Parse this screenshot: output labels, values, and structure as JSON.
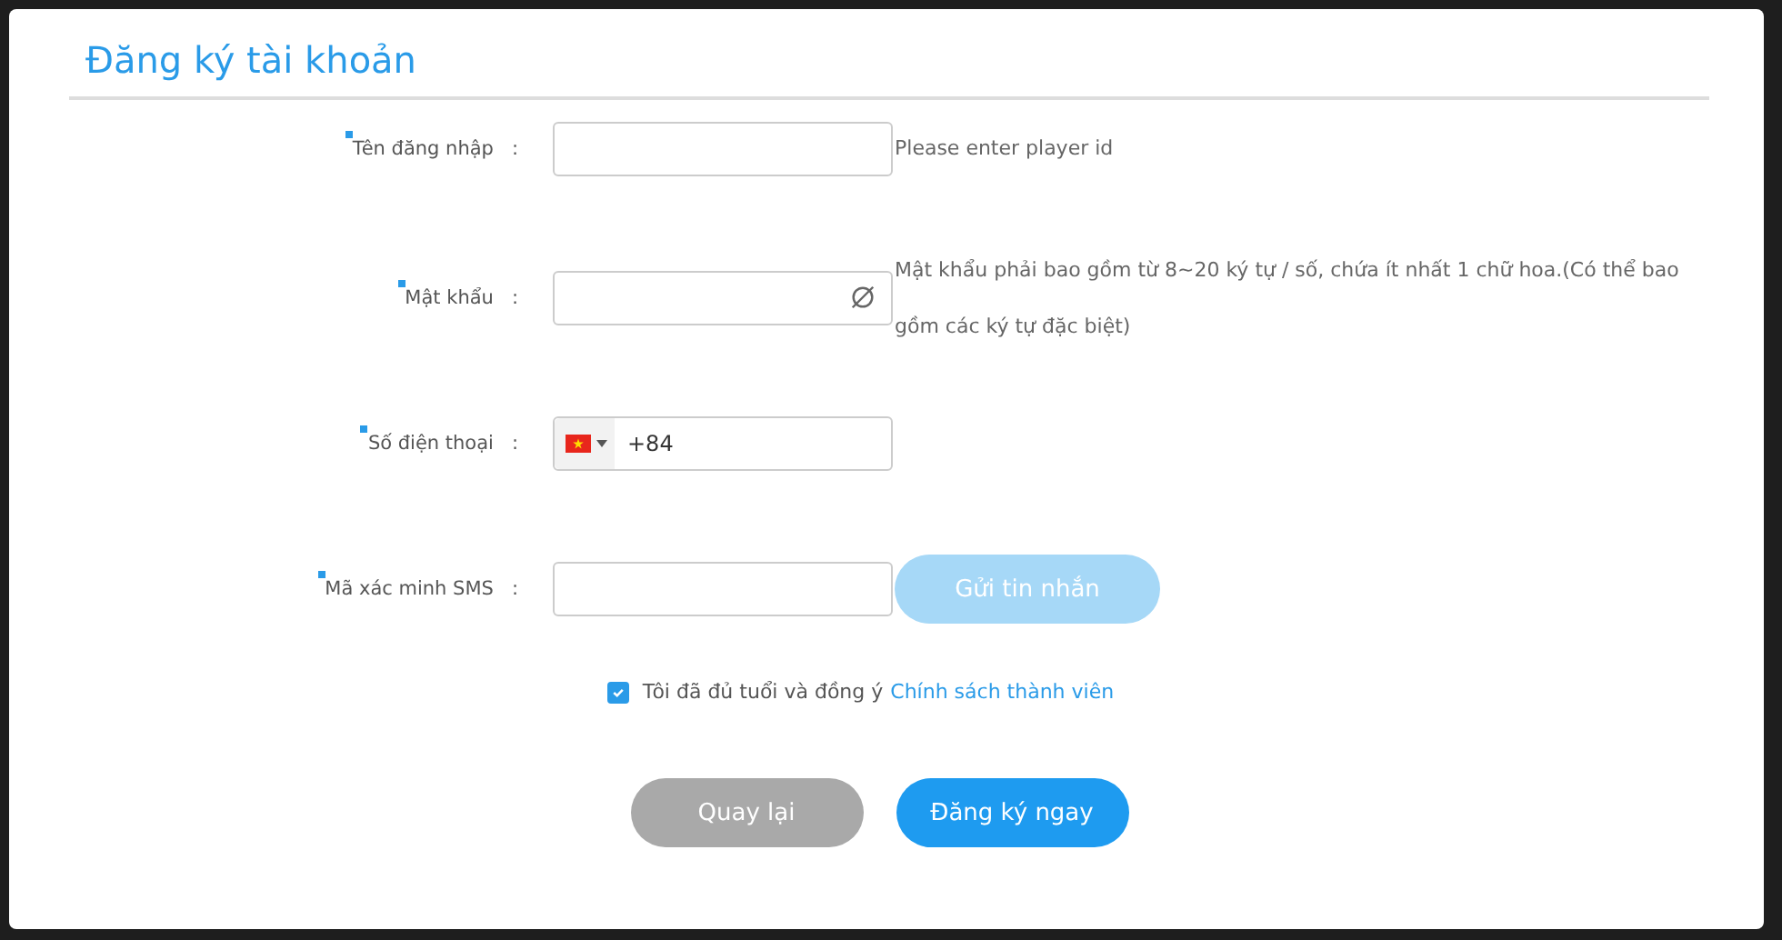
{
  "title": "Đăng ký tài khoản",
  "fields": [
    {
      "kind": "text",
      "label": "Tên đăng nhập",
      "required": true,
      "hint": "Please enter player id"
    },
    {
      "kind": "password",
      "label": "Mật khẩu",
      "required": true,
      "hint": "Mật khẩu phải bao gồm từ 8~20 ký tự / số, chứa ít nhất 1 chữ hoa.(Có thể bao gồm các ký tự đặc biệt)"
    },
    {
      "kind": "phone",
      "label": "Số điện thoại",
      "required": true,
      "value": "+84"
    },
    {
      "kind": "sms",
      "label": "Mã xác minh SMS",
      "required": true,
      "button": {
        "label": "Gửi tin nhắn",
        "disabled": true
      }
    }
  ],
  "separator": ":",
  "agreement": {
    "checked": true,
    "text": "Tôi đã đủ tuổi và đồng ý",
    "link": "Chính sách thành viên"
  },
  "buttons": [
    {
      "kind": "secondary",
      "label": "Quay lại"
    },
    {
      "kind": "primary",
      "label": "Đăng ký ngay"
    }
  ]
}
